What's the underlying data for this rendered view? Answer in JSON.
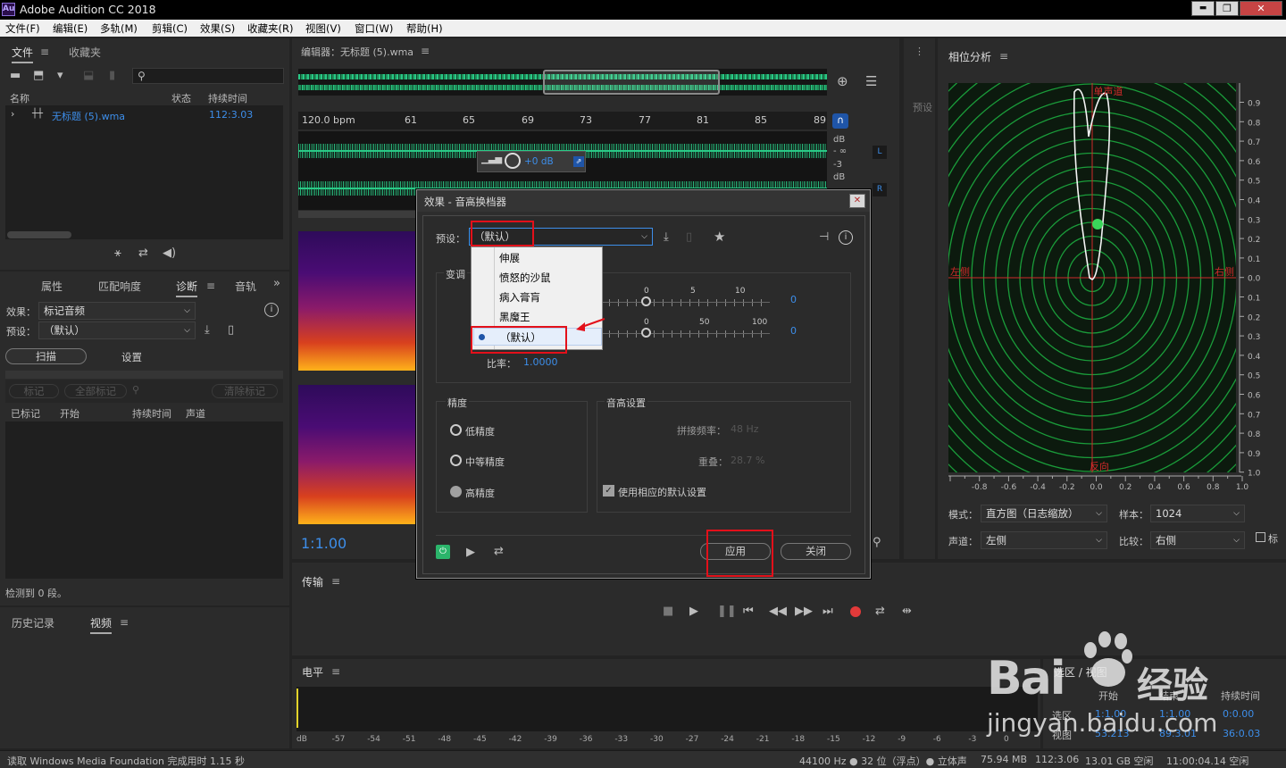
{
  "app": {
    "logo": "Au",
    "title": "Adobe Audition CC 2018"
  },
  "window_controls": {
    "minimize": "▬",
    "maximize": "❐",
    "close": "✕"
  },
  "menu": [
    "文件(F)",
    "编辑(E)",
    "多轨(M)",
    "剪辑(C)",
    "效果(S)",
    "收藏夹(R)",
    "视图(V)",
    "窗口(W)",
    "帮助(H)"
  ],
  "files_panel": {
    "tabs": [
      "文件",
      "收藏夹"
    ],
    "columns": [
      "名称",
      "状态",
      "持续时间"
    ],
    "file_name": "无标题 (5).wma",
    "file_duration": "112:3.03"
  },
  "diag_panel": {
    "tabs": [
      "属性",
      "匹配响度",
      "诊断",
      "音轨"
    ],
    "effect_label": "效果：",
    "effect_value": "标记音频",
    "preset_label": "预设：",
    "preset_value": "（默认）",
    "scan_label": "扫描",
    "settings_label": "设置",
    "btn_mark": "标记",
    "btn_mark_all": "全部标记",
    "btn_clear": "清除标记",
    "columns": [
      "已标记",
      "开始",
      "持续时间",
      "声道"
    ],
    "status": "检测到 0 段。"
  },
  "bottom_left_tabs": [
    "历史记录",
    "视频"
  ],
  "editor": {
    "title": "编辑器：无标题 (5).wma",
    "bpm": "120.0 bpm",
    "ruler": [
      "61",
      "65",
      "69",
      "73",
      "77",
      "81",
      "85",
      "89"
    ],
    "db_labels": [
      "dB",
      "- ∞",
      "-3",
      "dB"
    ],
    "channels": [
      "L",
      "R"
    ],
    "hud_gain": "+0 dB",
    "time": "1:1.00"
  },
  "preset_strip": "预设",
  "dialog": {
    "title": "效果 - 音高换档器",
    "preset_label": "预设：",
    "preset_value": "（默认）",
    "dropdown_options": [
      "伸展",
      "愤怒的沙鼠",
      "病入膏肓",
      "黑魔王",
      "（默认）"
    ],
    "section_pitch": "变调",
    "scale1": [
      "0",
      "5",
      "10"
    ],
    "scale2": [
      "0",
      "50",
      "100"
    ],
    "value1": "0",
    "value2": "0",
    "ratio_label": "比率：",
    "ratio_value": "1.0000",
    "section_precision": "精度",
    "precision": [
      "低精度",
      "中等精度",
      "高精度"
    ],
    "section_pitch_settings": "音高设置",
    "splice_label": "拼接频率：",
    "splice_value": "48 Hz",
    "overlap_label": "重叠：",
    "overlap_value": "28.7 %",
    "use_default": "使用相应的默认设置",
    "apply": "应用",
    "close": "关闭"
  },
  "transport": {
    "title": "传输"
  },
  "levels": {
    "title": "电平",
    "scale": [
      "dB",
      "-57",
      "-54",
      "-51",
      "-48",
      "-45",
      "-42",
      "-39",
      "-36",
      "-33",
      "-30",
      "-27",
      "-24",
      "-21",
      "-18",
      "-15",
      "-12",
      "-9",
      "-6",
      "-3",
      "0"
    ]
  },
  "selection_panel": {
    "title": "选区 / 视图",
    "col_start": "开始",
    "col_end": "结束",
    "col_duration": "持续时间",
    "row_sel": "选区",
    "row_view": "视图",
    "sel": [
      "1:1.00",
      "1:1.00",
      "0:0.00"
    ],
    "view": [
      "53.213",
      "89.3.01",
      "36:0.03"
    ]
  },
  "phase": {
    "title": "相位分析",
    "top_label": "单声道",
    "left_label": "左侧",
    "right_label": "右侧",
    "bottom_label": "反向",
    "y_ticks": [
      "0.9",
      "0.8",
      "0.7",
      "0.6",
      "0.5",
      "0.4",
      "0.3",
      "0.2",
      "0.1",
      "0.0",
      "0.1",
      "0.2",
      "0.3",
      "0.4",
      "0.5",
      "0.6",
      "0.7",
      "0.8",
      "0.9",
      "1.0"
    ],
    "x_ticks": [
      "-0.8",
      "-0.6",
      "-0.4",
      "-0.2",
      "0.0",
      "0.2",
      "0.4",
      "0.6",
      "0.8",
      "1.0"
    ],
    "mode_label": "模式：",
    "mode_value": "直方图（日志缩放）",
    "sample_label": "样本：",
    "sample_value": "1024",
    "channel_label": "声道：",
    "channel_value": "左侧",
    "compare_label": "比较：",
    "compare_value": "右侧",
    "check_label": "标"
  },
  "statusbar": {
    "left": "读取 Windows Media Foundation 完成用时 1.15 秒",
    "items": [
      "44100 Hz ● 32 位（浮点）● 立体声",
      "75.94 MB",
      "112:3.06",
      "13.01 GB 空闲",
      "11:00:04.14 空闲"
    ]
  },
  "watermark": {
    "brand": "Bai",
    "brand2": "经验",
    "url": "jingyan.baidu.com"
  },
  "colors": {
    "accent_blue": "#3d8eea",
    "highlight_red": "#e3101a",
    "waveform": "#29c986",
    "grid_green": "#1a9c3a"
  }
}
